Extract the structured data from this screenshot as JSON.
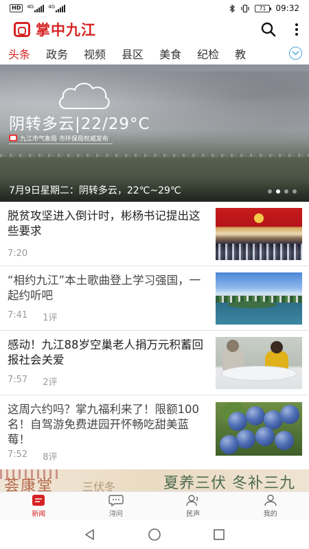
{
  "status_bar": {
    "hd": "HD",
    "net1": "4G",
    "net2": "4G",
    "battery": "71",
    "time": "09:32"
  },
  "app": {
    "name": "掌中九江",
    "brand_color": "#d62323"
  },
  "tabs": [
    {
      "label": "头条",
      "active": true
    },
    {
      "label": "政务"
    },
    {
      "label": "视频"
    },
    {
      "label": "县区"
    },
    {
      "label": "美食"
    },
    {
      "label": "纪检"
    },
    {
      "label": "教"
    }
  ],
  "banner": {
    "weather": "阴转多云|22/29°C",
    "source": "九江市气象局  市环保局权威发布",
    "caption": "7月9日星期二：阴转多云，22℃~29℃",
    "dots_total": 4,
    "dots_active": 2
  },
  "news": [
    {
      "title": "脱贫攻坚进入倒计时，彬杨书记提出这些要求",
      "time": "7:20",
      "comments": ""
    },
    {
      "title": "“相约九江”本土歌曲登上学习强国，一起约听吧",
      "time": "7:41",
      "comments": "1评"
    },
    {
      "title": "感动！九江88岁空巢老人捐万元积蓄回报社会关爱",
      "time": "7:57",
      "comments": "2评"
    },
    {
      "title": "这周六约吗？掌九福利来了！限额100名！自驾游免费进园开怀畅吃甜美蓝莓！",
      "time": "7:52",
      "comments": "8评"
    }
  ],
  "promo": {
    "left": "荟康堂",
    "mid": "三伏冬",
    "right": "夏养三伏 冬补三九"
  },
  "bottom_nav": [
    {
      "label": "新闻",
      "icon": "news-icon",
      "active": true
    },
    {
      "label": "浔问",
      "icon": "chat-icon"
    },
    {
      "label": "民声",
      "icon": "voice-icon"
    },
    {
      "label": "我的",
      "icon": "user-icon"
    }
  ]
}
